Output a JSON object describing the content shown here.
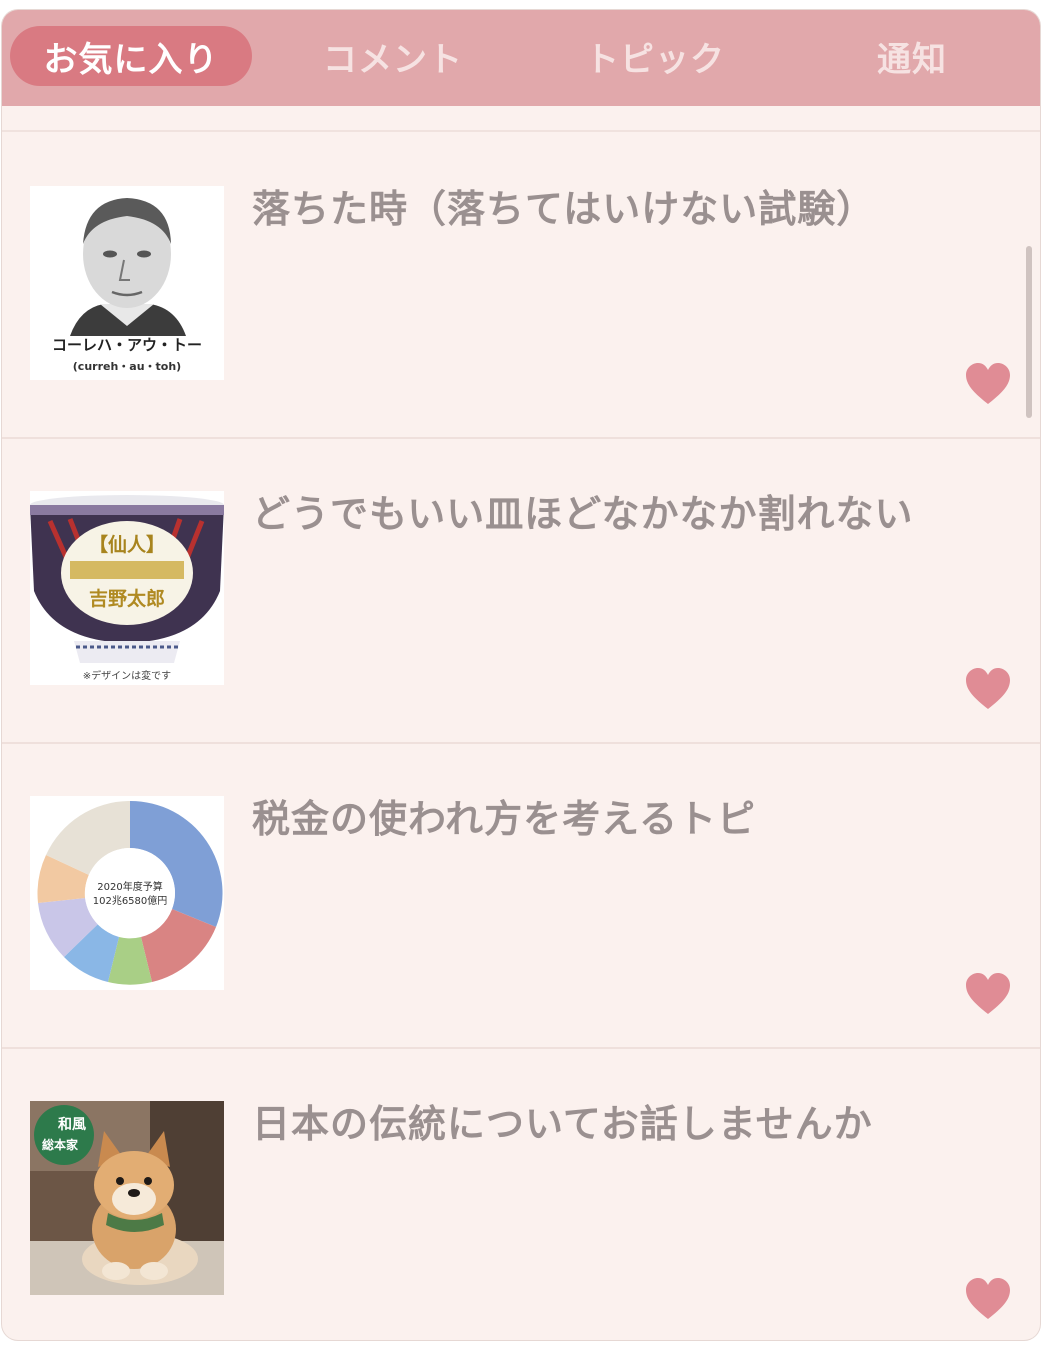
{
  "tabs": [
    {
      "label": "お気に入り",
      "active": true
    },
    {
      "label": "コメント",
      "active": false
    },
    {
      "label": "トピック",
      "active": false
    },
    {
      "label": "通知",
      "active": false
    }
  ],
  "favorites": [
    {
      "title": "落ちた時（落ちてはいけない試験）",
      "thumbnail": "portrait-sketch",
      "thumbnail_text": [
        "コーレハ・アウ・トー",
        "(curreh・au・toh)"
      ]
    },
    {
      "title": "どうでもいい皿ほどなかなか割れない",
      "thumbnail": "rice-bowl",
      "thumbnail_text": [
        "【仙人】",
        "吉野太郎",
        "※デザインは変です"
      ]
    },
    {
      "title": "税金の使われ方を考えるトピ",
      "thumbnail": "donut-chart",
      "thumbnail_text": [
        "2020年度予算",
        "102兆6580億円"
      ]
    },
    {
      "title": "日本の伝統についてお話しませんか",
      "thumbnail": "shiba-puppy",
      "thumbnail_text": [
        "和風",
        "総本家"
      ]
    }
  ],
  "icons": {
    "favorite": "heart-icon",
    "heart_color": "#e08c95"
  },
  "colors": {
    "tabbar": "#e1a8ab",
    "active_tab": "#d97a82",
    "background": "#fbf1ee",
    "title_text": "#9a9090"
  }
}
